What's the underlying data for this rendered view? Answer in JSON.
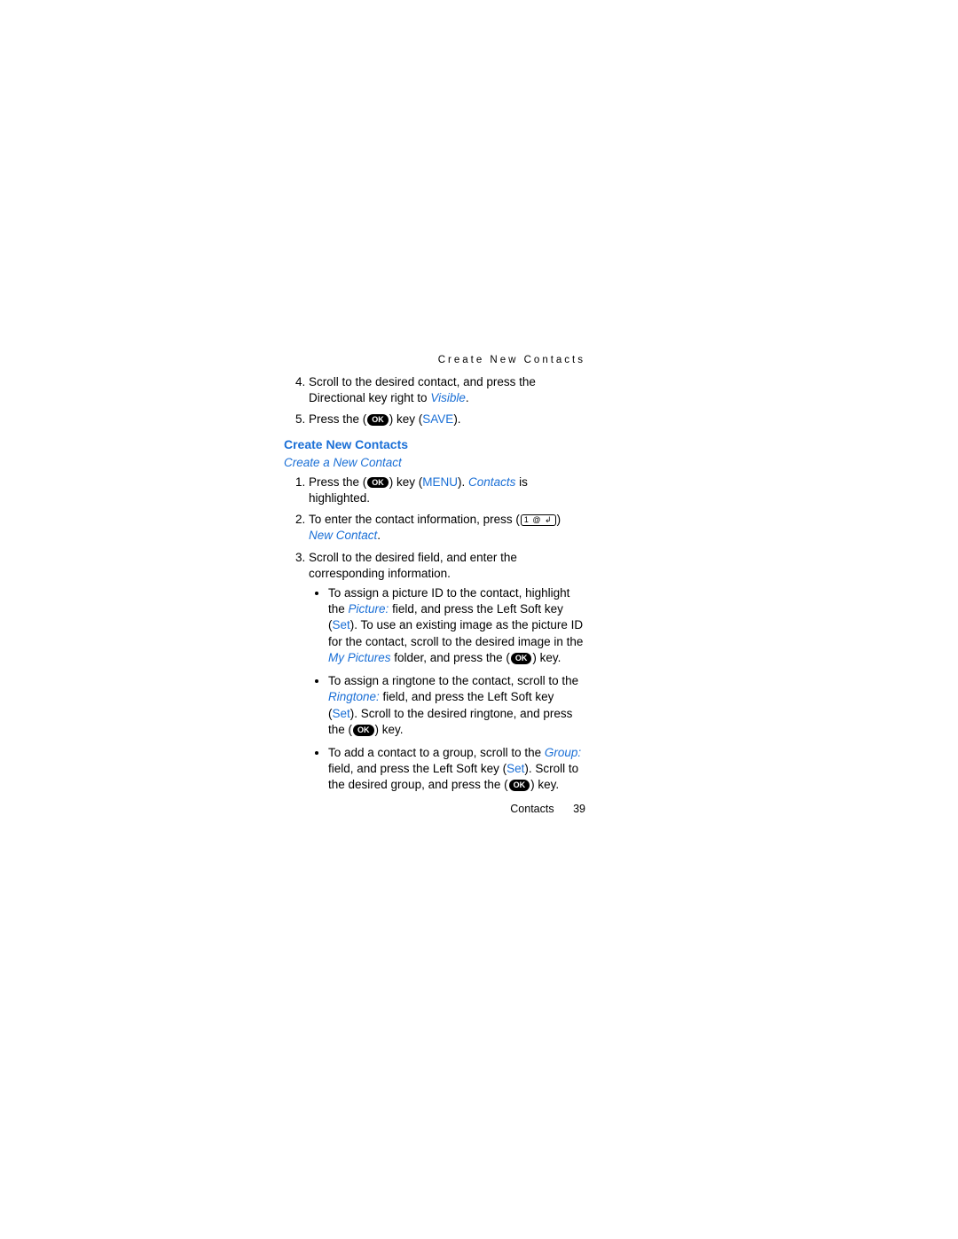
{
  "header": "Create New Contacts",
  "top_list": {
    "item4_a": "Scroll to the desired contact, and press the Directional key right to ",
    "item4_visible": "Visible",
    "item4_b": ".",
    "item5_a": "Press the (",
    "ok": "OK",
    "item5_b": ") key (",
    "save": "SAVE",
    "item5_c": ")."
  },
  "section_title": "Create New Contacts",
  "subsection_title": "Create a New Contact",
  "list2": {
    "s1_a": "Press the (",
    "s1_b": ") key (",
    "menu": "MENU",
    "s1_c": "). ",
    "contacts": "Contacts",
    "s1_d": " is highlighted.",
    "s2_a": "To enter the contact information, press (",
    "alt_key": "1 @ ↲",
    "s2_b": ") ",
    "new_contact": "New Contact",
    "s2_c": ".",
    "s3": "Scroll to the desired field, and enter the corresponding information.",
    "b1_a": "To assign a picture ID to the contact, highlight the ",
    "picture": "Picture:",
    "b1_b": " field, and press the Left Soft key (",
    "set": "Set",
    "b1_c": "). To use an existing image as the picture ID for the contact, scroll to the desired image in the ",
    "my_pictures": "My Pictures",
    "b1_d": " folder, and press the (",
    "b1_e": ") key.",
    "b2_a": "To assign a ringtone to the contact, scroll to the ",
    "ringtone": "Ringtone:",
    "b2_b": " field, and press the Left Soft key (",
    "b2_c": "). Scroll to the desired ringtone, and press the (",
    "b2_d": ") key.",
    "b3_a": "To add a contact to a group, scroll to the ",
    "group": "Group:",
    "b3_b": " field, and press the Left Soft key (",
    "b3_c": "). Scroll to the desired group, and press the (",
    "b3_d": ") key."
  },
  "footer": {
    "chapter": "Contacts",
    "page": "39"
  }
}
